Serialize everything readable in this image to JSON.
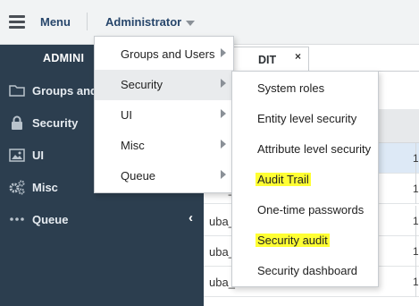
{
  "topbar": {
    "menu_label": "Menu",
    "admin_label": "Administrator"
  },
  "sidebar": {
    "header": "ADMINI",
    "items": [
      {
        "label": "Groups and",
        "icon": "folder-icon"
      },
      {
        "label": "Security",
        "icon": "lock-icon"
      },
      {
        "label": "UI",
        "icon": "image-icon"
      },
      {
        "label": "Misc",
        "icon": "gears-icon"
      },
      {
        "label": "Queue",
        "icon": "dots-icon"
      }
    ],
    "collapse_glyph": "‹"
  },
  "content": {
    "tab_label": "DIT",
    "tab_close": "×",
    "rows": [
      {
        "text": "",
        "digit": "1"
      },
      {
        "text": "uba_",
        "digit": "1"
      },
      {
        "text": "uba_",
        "digit": "1"
      },
      {
        "text": "uba_",
        "digit": "1"
      },
      {
        "text": "uba_els",
        "digit": "1"
      }
    ]
  },
  "menu_admin": {
    "items": [
      {
        "label": "Groups and Users",
        "has_submenu": true
      },
      {
        "label": "Security",
        "has_submenu": true,
        "active": true
      },
      {
        "label": "UI",
        "has_submenu": true
      },
      {
        "label": "Misc",
        "has_submenu": true
      },
      {
        "label": "Queue",
        "has_submenu": true
      }
    ]
  },
  "menu_security": {
    "items": [
      {
        "label": "System roles",
        "highlighted": false
      },
      {
        "label": "Entity level security",
        "highlighted": false
      },
      {
        "label": "Attribute level security",
        "highlighted": false
      },
      {
        "label": "Audit Trail",
        "highlighted": true
      },
      {
        "label": "One-time passwords",
        "highlighted": false
      },
      {
        "label": "Security audit",
        "highlighted": true
      },
      {
        "label": "Security dashboard",
        "highlighted": false
      }
    ]
  },
  "colors": {
    "sidebar_bg": "#2c3e4f",
    "topbar_bg": "#f1f3f4",
    "link_blue": "#27466b",
    "highlight_yellow": "#ffff33"
  }
}
